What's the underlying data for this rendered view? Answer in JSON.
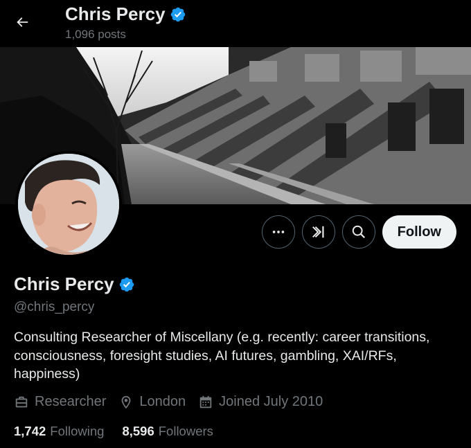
{
  "header": {
    "title": "Chris Percy",
    "posts_count": "1,096 posts"
  },
  "profile": {
    "name": "Chris Percy",
    "handle": "@chris_percy",
    "verified": true,
    "bio": "Consulting Researcher of Miscellany (e.g. recently: career transitions, consciousness, foresight studies, AI futures, gambling, XAI/RFs, happiness)",
    "occupation": "Researcher",
    "location": "London",
    "joined": "Joined July 2010",
    "following_count": "1,742",
    "following_label": "Following",
    "followers_count": "8,596",
    "followers_label": "Followers"
  },
  "actions": {
    "follow_label": "Follow",
    "more_icon": "ellipsis-icon",
    "grok_icon": "grok-icon",
    "search_icon": "search-icon"
  },
  "colors": {
    "background": "#000000",
    "text_primary": "#e7e9ea",
    "text_secondary": "#71767b",
    "verified_badge": "#1d9bf0",
    "follow_button_bg": "#eff3f4"
  }
}
